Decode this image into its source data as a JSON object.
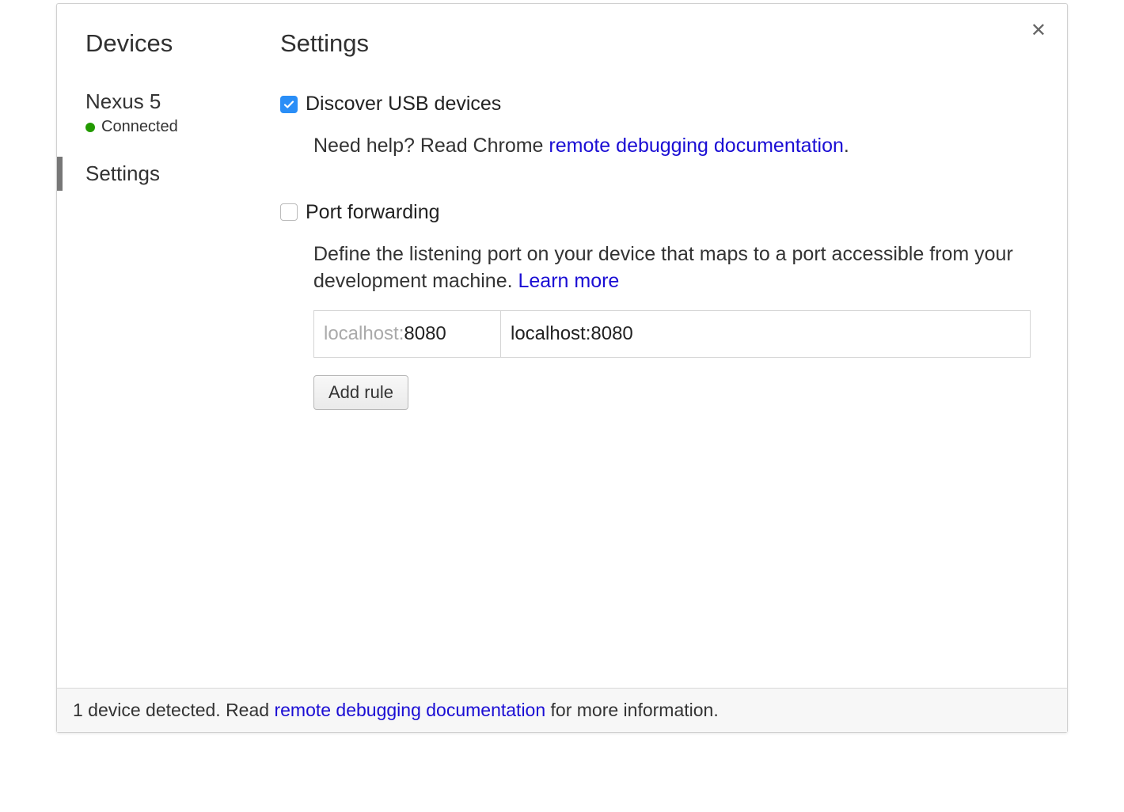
{
  "sidebar": {
    "title": "Devices",
    "device": {
      "name": "Nexus 5",
      "status": "Connected"
    },
    "settings_label": "Settings"
  },
  "main": {
    "title": "Settings",
    "usb": {
      "checkbox_label": "Discover USB devices",
      "help_prefix": "Need help? Read Chrome ",
      "help_link": "remote debugging documentation",
      "help_suffix": "."
    },
    "port_forwarding": {
      "checkbox_label": "Port forwarding",
      "desc_prefix": "Define the listening port on your device that maps to a port accessible from your development machine. ",
      "learn_more": "Learn more",
      "cell_left_prefix": "localhost:",
      "cell_left_value": "8080",
      "cell_right": "localhost:8080",
      "add_rule": "Add rule"
    }
  },
  "footer": {
    "text_prefix": "1 device detected. Read ",
    "link": "remote debugging documentation",
    "text_suffix": " for more information."
  },
  "close_icon": "✕"
}
